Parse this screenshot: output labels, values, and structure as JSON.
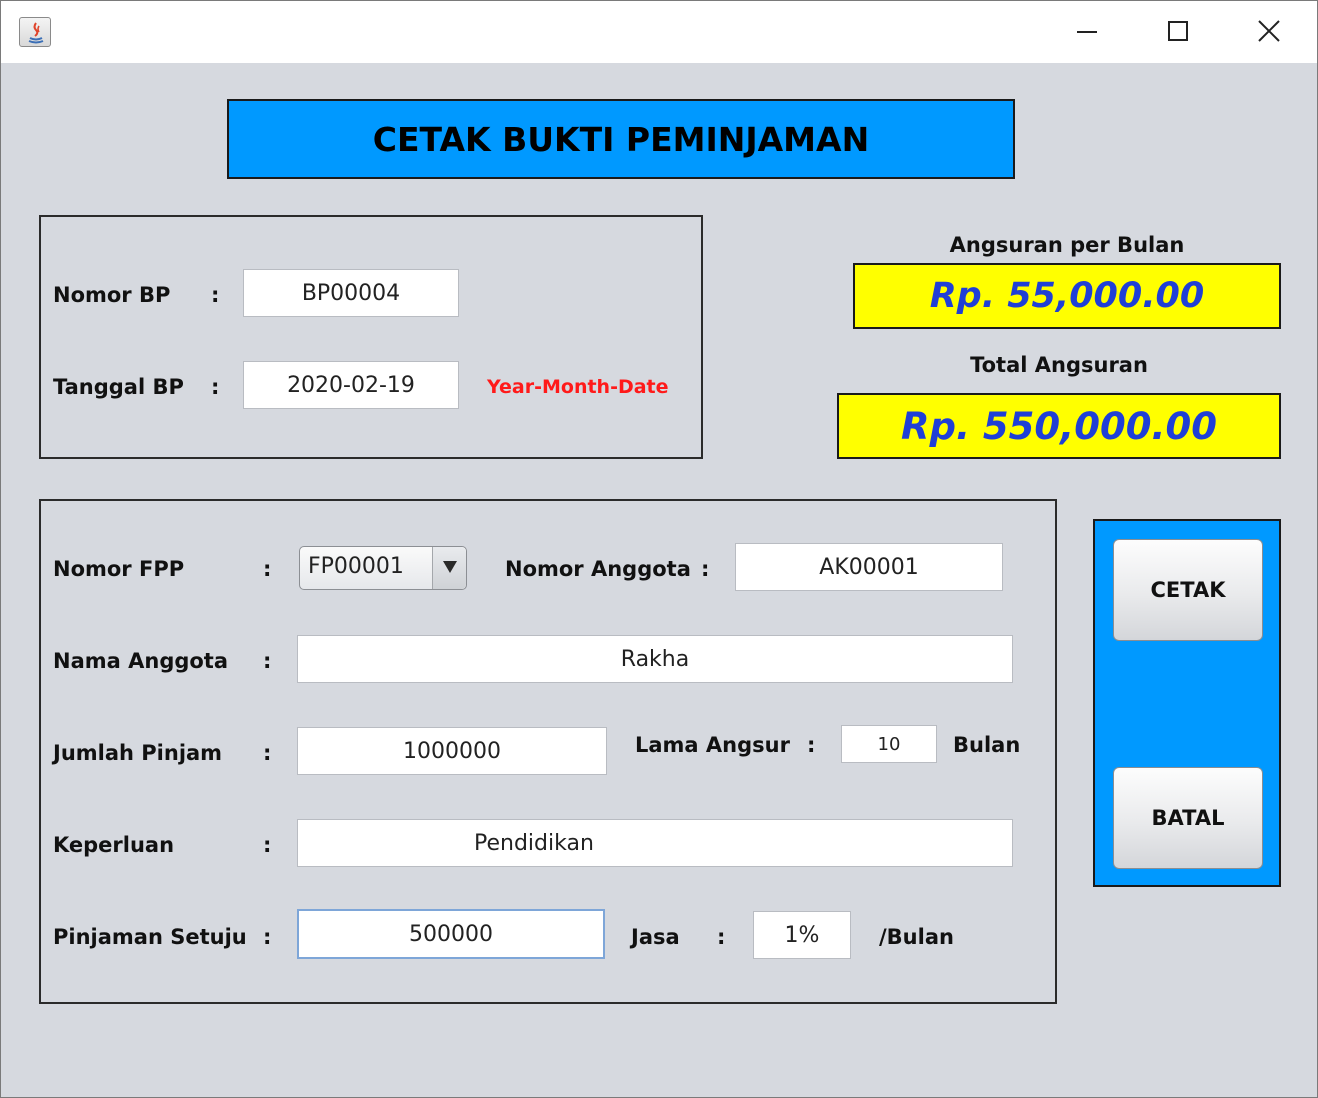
{
  "window": {
    "title": "",
    "controls": {
      "minimize": "minimize",
      "maximize": "maximize",
      "close": "close"
    }
  },
  "header": {
    "title": "CETAK BUKTI PEMINJAMAN"
  },
  "bp_panel": {
    "nomor_bp": {
      "label": "Nomor BP",
      "colon": ":",
      "value": "BP00004"
    },
    "tanggal_bp": {
      "label": "Tanggal BP",
      "colon": ":",
      "value": "2020-02-19",
      "hint": "Year-Month-Date"
    }
  },
  "summary": {
    "angsuran_per_bulan": {
      "label": "Angsuran per Bulan",
      "value": "Rp. 55,000.00"
    },
    "total_angsuran": {
      "label": "Total Angsuran",
      "value": "Rp. 550,000.00"
    },
    "highlight_color": "#ffff00",
    "value_color": "#1f3fd6"
  },
  "form": {
    "nomor_fpp": {
      "label": "Nomor FPP",
      "colon": ":",
      "selected": "FP00001"
    },
    "nomor_anggota": {
      "label": "Nomor Anggota",
      "colon": ":",
      "value": "AK00001"
    },
    "nama_anggota": {
      "label": "Nama Anggota",
      "colon": ":",
      "value": "Rakha"
    },
    "jumlah_pinjam": {
      "label": "Jumlah Pinjam",
      "colon": ":",
      "value": "1000000"
    },
    "lama_angsur": {
      "label": "Lama Angsur",
      "colon": ":",
      "value": "10",
      "unit": "Bulan"
    },
    "keperluan": {
      "label": "Keperluan",
      "colon": ":",
      "value": "Pendidikan"
    },
    "pinjaman_setuju": {
      "label": "Pinjaman Setuju",
      "colon": ":",
      "value": "500000"
    },
    "jasa": {
      "label": "Jasa",
      "colon": ":",
      "value": "1%",
      "unit": "/Bulan"
    }
  },
  "actions": {
    "cetak": "CETAK",
    "batal": "BATAL"
  },
  "colors": {
    "accent": "#0099ff",
    "background": "#d6d9df",
    "hint": "#ff1a1a"
  },
  "icons": [
    "java-app-icon",
    "minimize-icon",
    "maximize-icon",
    "close-icon",
    "dropdown-arrow-icon"
  ]
}
